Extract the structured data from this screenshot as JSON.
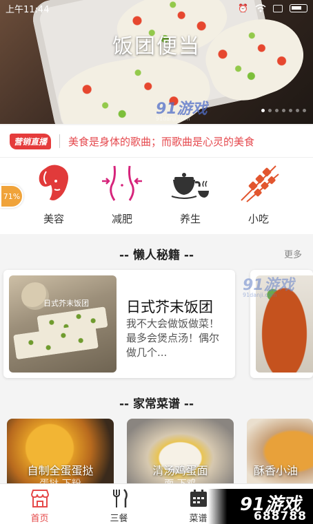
{
  "status_bar": {
    "time": "上午11:44"
  },
  "hero": {
    "title": "饭团便当",
    "watermark": "91游戏",
    "watermark_site": "91danji.com"
  },
  "ticker": {
    "badge": "营销直播",
    "text": "美食是身体的歌曲；而歌曲是心灵的美食"
  },
  "side_badge": "71%",
  "categories": [
    {
      "label": "美容",
      "icon": "beauty-face-icon"
    },
    {
      "label": "减肥",
      "icon": "waist-slim-icon"
    },
    {
      "label": "养生",
      "icon": "teapot-icon"
    },
    {
      "label": "小吃",
      "icon": "skewers-icon"
    }
  ],
  "lazy_section": {
    "title": "-- 懒人秘籍 --",
    "more": "更多",
    "cards": [
      {
        "title": "日式芥末饭团",
        "desc": "我不大会做饭做菜！最多会煲点汤！偶尔做几个...",
        "thumb_caption": "日式芥末饭团"
      }
    ],
    "watermark": "91游戏",
    "watermark_site": "91danji.com"
  },
  "home_section": {
    "title": "-- 家常菜谱 --",
    "cards": [
      {
        "caption": "自制全蛋蛋挞",
        "caption2": "蛋挞   下粉"
      },
      {
        "caption": "清汤鸡蛋面",
        "caption2": "面   下鸡"
      },
      {
        "caption": "酥香小油",
        "caption2": ""
      }
    ]
  },
  "tabs": [
    {
      "label": "首页",
      "icon": "home-icon",
      "active": true
    },
    {
      "label": "三餐",
      "icon": "fork-knife-icon",
      "active": false
    },
    {
      "label": "菜谱",
      "icon": "calendar-icon",
      "active": false
    }
  ],
  "corner_logo": {
    "brand": "91游戏",
    "number": "688788"
  },
  "colors": {
    "accent": "#e54848",
    "ticker_text": "#e5484d",
    "badge_orange": "#f0a33a"
  }
}
